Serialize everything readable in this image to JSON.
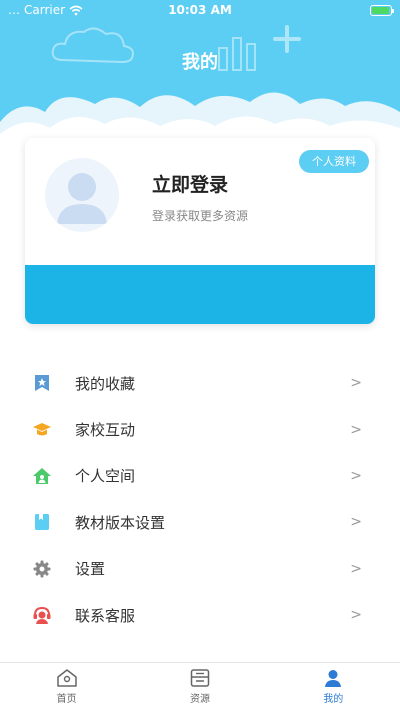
{
  "status_bar": {
    "carrier": "Carrier",
    "time": "10:03 AM"
  },
  "header": {
    "title": "我的"
  },
  "profile": {
    "login_title": "立即登录",
    "login_subtitle": "登录获取更多资源",
    "profile_button": "个人资料"
  },
  "menu": {
    "items": [
      {
        "label": "我的收藏",
        "icon": "bookmark-star-icon",
        "color": "#5b9bd5"
      },
      {
        "label": "家校互动",
        "icon": "graduation-cap-icon",
        "color": "#f5a623"
      },
      {
        "label": "个人空间",
        "icon": "home-person-icon",
        "color": "#4cc96a"
      },
      {
        "label": "教材版本设置",
        "icon": "book-icon",
        "color": "#5ccdf3"
      },
      {
        "label": "设置",
        "icon": "gear-icon",
        "color": "#888888"
      },
      {
        "label": "联系客服",
        "icon": "headset-icon",
        "color": "#e94f4f"
      }
    ],
    "chevron": ">"
  },
  "tabbar": {
    "tabs": [
      {
        "label": "首页",
        "icon": "home-icon",
        "active": false
      },
      {
        "label": "资源",
        "icon": "resource-box-icon",
        "active": false
      },
      {
        "label": "我的",
        "icon": "user-icon",
        "active": true
      }
    ]
  },
  "colors": {
    "header_bg": "#5ccdf3",
    "card_band": "#1cb4e7",
    "accent": "#2d7bd5"
  }
}
